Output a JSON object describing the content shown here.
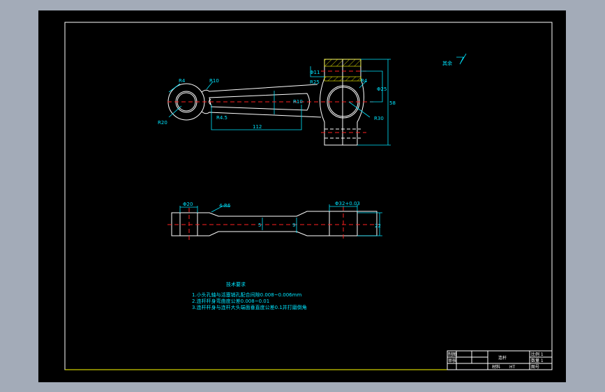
{
  "colors": {
    "background": "#a3abb8",
    "canvas": "#000000",
    "outline": "#ffffff",
    "dimension": "#00e5ff",
    "centerline": "#ff2020",
    "hatch": "#ffff00"
  },
  "top_view": {
    "dims": {
      "r4": "R4",
      "r10a": "R10",
      "r20": "R20",
      "r45": "R4.5",
      "len": "112",
      "r10b": "R10",
      "r30": "R30",
      "d25": "Φ25",
      "r4b": "R4",
      "h58": "58",
      "d11": "Φ11",
      "r25": "R25"
    }
  },
  "front_view": {
    "dims": {
      "d20": "Φ20",
      "r6": "4-R6",
      "d32": "Φ32+0.03",
      "h22": "22",
      "w5": "5",
      "w9": "9"
    }
  },
  "roughness": {
    "label": "其余",
    "symbol": "roughness-symbol"
  },
  "tech_requirements": {
    "title": "技术要求",
    "items": [
      "1.小头孔轴与活塞销孔配合间隙0.008~0.006mm",
      "2.连杆杆身弯曲度公差0.008~0.01",
      "3.连杆杆身与连杆大头端面垂直度公差0.1并打磨倒角"
    ]
  },
  "title_block": {
    "part_name": "连杆",
    "r1c1": "制图",
    "r2c1": "审核",
    "r3c1": "材料",
    "r3c2": "HT",
    "s1": "比例 1",
    "s2": "数量 1",
    "s3": "图号"
  }
}
